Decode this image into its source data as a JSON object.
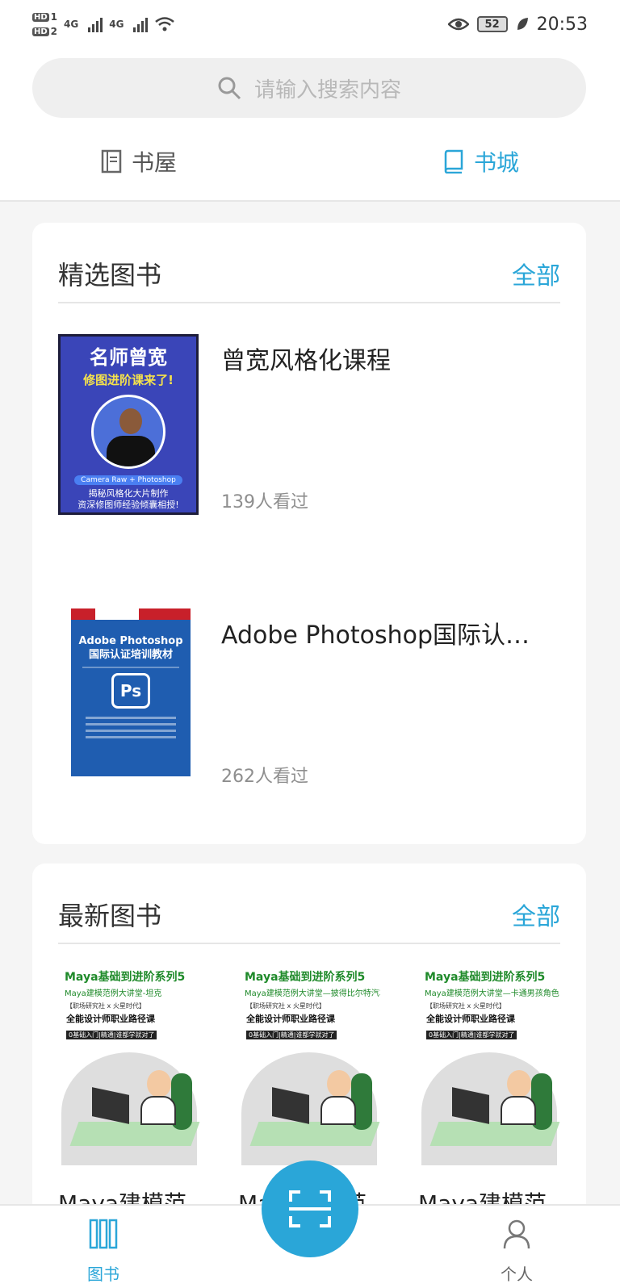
{
  "status_bar": {
    "hd1": "HD",
    "hd1_sub": "1",
    "hd2": "HD",
    "hd2_sub": "2",
    "net1": "4G",
    "net2": "4G",
    "battery": "52",
    "time": "20:53"
  },
  "search": {
    "placeholder": "请输入搜索内容"
  },
  "top_tabs": [
    {
      "label": "书屋",
      "icon": "book-shelf-icon",
      "active": false
    },
    {
      "label": "书城",
      "icon": "book-store-icon",
      "active": true
    }
  ],
  "featured": {
    "title": "精选图书",
    "all_label": "全部",
    "books": [
      {
        "title": "曾宽风格化课程",
        "views": "139人看过",
        "cover": {
          "line1": "名师曾宽",
          "line2": "修图进阶课来了!",
          "pill": "Camera Raw + Photoshop",
          "foot1": "揭秘风格化大片制作",
          "foot2": "资深修图师经验倾囊相授!"
        }
      },
      {
        "title": "Adobe Photoshop国际认…",
        "views": "262人看过",
        "cover": {
          "line1": "Adobe Photoshop",
          "line2": "国际认证培训教材",
          "logo": "Ps"
        }
      }
    ]
  },
  "latest": {
    "title": "最新图书",
    "all_label": "全部",
    "books": [
      {
        "name": "Maya建模范",
        "cover": {
          "t1": "Maya基础到进阶系列5",
          "t2": "Maya建模范例大讲堂-坦克",
          "t3": "【职场研究社 x 火星时代】",
          "t4": "全能设计师职业路径课",
          "t5": "0基础入门|精通|谁都学就对了"
        }
      },
      {
        "name": "Maya建模范",
        "cover": {
          "t1": "Maya基础到进阶系列5",
          "t2": "Maya建模范例大讲堂—披得比尔特汽车",
          "t3": "【职场研究社 x 火星时代】",
          "t4": "全能设计师职业路径课",
          "t5": "0基础入门|精通|谁都学就对了"
        }
      },
      {
        "name": "Maya建模范",
        "cover": {
          "t1": "Maya基础到进阶系列5",
          "t2": "Maya建模范例大讲堂—卡通男孩角色",
          "t3": "【职场研究社 x 火星时代】",
          "t4": "全能设计师职业路径课",
          "t5": "0基础入门|精通|谁都学就对了"
        }
      }
    ]
  },
  "bottom_nav": {
    "books_label": "图书",
    "me_label": "个人",
    "scan_icon": "scan-icon"
  },
  "colors": {
    "accent": "#2aa6d8",
    "background": "#f5f5f5",
    "card": "#ffffff"
  }
}
